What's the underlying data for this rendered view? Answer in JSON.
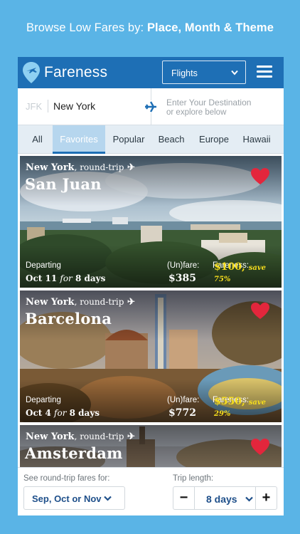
{
  "promo": {
    "prefix": "Browse Low Fares by: ",
    "bold": "Place, Month & Theme"
  },
  "header": {
    "logo_text": "Fareness",
    "mode_select": "Flights"
  },
  "search": {
    "origin_code": "JFK",
    "origin_city": "New York",
    "destination_placeholder": "Enter Your Destination",
    "destination_sub": "or explore below"
  },
  "tabs": [
    {
      "label": "All"
    },
    {
      "label": "Favorites",
      "active": true
    },
    {
      "label": "Popular"
    },
    {
      "label": "Beach"
    },
    {
      "label": "Europe"
    },
    {
      "label": "Hawaii"
    }
  ],
  "deals": [
    {
      "origin": "New York",
      "trip_type": ", round-trip",
      "destination": "San Juan",
      "departing_label": "Departing",
      "date": "Oct 11",
      "for": "for",
      "duration": "8 days",
      "unfare_label": "(Un)fare:",
      "unfare": "$385",
      "fareness_label": "Fareness:",
      "fareness": "$100,",
      "save": "save 75%"
    },
    {
      "origin": "New York",
      "trip_type": ", round-trip",
      "destination": "Barcelona",
      "departing_label": "Departing",
      "date": "Oct 4",
      "for": "for",
      "duration": "8 days",
      "unfare_label": "(Un)fare:",
      "unfare": "$772",
      "fareness_label": "Fareness:",
      "fareness": "$550,",
      "save": "save 29%"
    },
    {
      "origin": "New York",
      "trip_type": ", round-trip",
      "destination": "Amsterdam"
    }
  ],
  "controls": {
    "months_label": "See round-trip fares for:",
    "months_value": "Sep, Oct or Nov",
    "trip_length_label": "Trip length:",
    "trip_length_value": "8 days",
    "minus": "−",
    "plus": "+"
  },
  "colors": {
    "background": "#5ab4e6",
    "header": "#1e6fb5",
    "heart": "#e3263c",
    "fareness_price": "#f5dd1d"
  }
}
